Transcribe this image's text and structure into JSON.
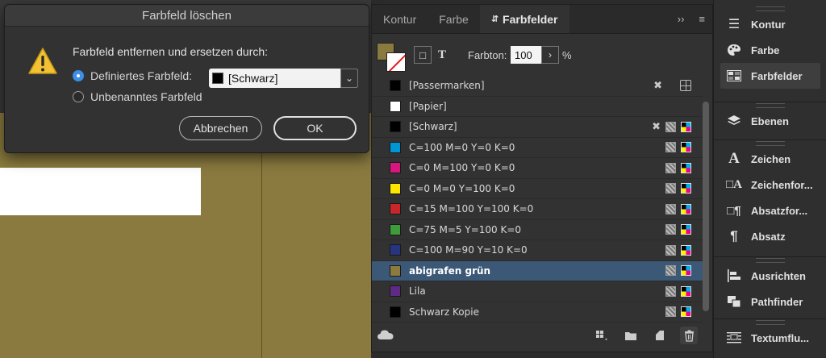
{
  "dialog": {
    "title": "Farbfeld löschen",
    "heading": "Farbfeld entfernen und ersetzen durch:",
    "option_defined": "Definiertes Farbfeld:",
    "option_unnamed": "Unbenanntes Farbfeld",
    "selected_swatch": "[Schwarz]",
    "cancel": "Abbrechen",
    "ok": "OK"
  },
  "panel": {
    "tabs": [
      "Kontur",
      "Farbe",
      "Farbfelder"
    ],
    "active_tab": "Farbfelder",
    "tint_label": "Farbton:",
    "tint_value": "100",
    "tint_unit": "%",
    "text_tool": "T",
    "swatches": [
      {
        "name": "[Passermarken]",
        "color": "#000000",
        "icons": "registration"
      },
      {
        "name": "[Papier]",
        "color": "#ffffff",
        "icons": "none"
      },
      {
        "name": "[Schwarz]",
        "color": "#000000",
        "icons": "locked-process"
      },
      {
        "name": "C=100 M=0 Y=0 K=0",
        "color": "#0096d6",
        "icons": "process"
      },
      {
        "name": "C=0 M=100 Y=0 K=0",
        "color": "#d8177e",
        "icons": "process"
      },
      {
        "name": "C=0 M=0 Y=100 K=0",
        "color": "#ffe600",
        "icons": "process"
      },
      {
        "name": "C=15 M=100 Y=100 K=0",
        "color": "#c8262a",
        "icons": "process"
      },
      {
        "name": "C=75 M=5 Y=100 K=0",
        "color": "#3f9c3a",
        "icons": "process"
      },
      {
        "name": "C=100 M=90 Y=10 K=0",
        "color": "#27347f",
        "icons": "process"
      },
      {
        "name": "abigrafen grün",
        "color": "#8a7a3f",
        "icons": "process",
        "selected": true
      },
      {
        "name": "Lila",
        "color": "#5e2a84",
        "icons": "process"
      },
      {
        "name": "Schwarz Kopie",
        "color": "#000000",
        "icons": "process"
      }
    ]
  },
  "dock": {
    "group1": [
      "Kontur",
      "Farbe",
      "Farbfelder"
    ],
    "group2": [
      "Ebenen"
    ],
    "group3": [
      "Zeichen",
      "Zeichenfor...",
      "Absatzfor...",
      "Absatz"
    ],
    "group4": [
      "Ausrichten",
      "Pathfinder"
    ],
    "group5": [
      "Textumflu..."
    ]
  },
  "colors": {
    "canvas": "#8a7a3f",
    "selection": "#3b5877",
    "accent": "#3d8ee6"
  }
}
